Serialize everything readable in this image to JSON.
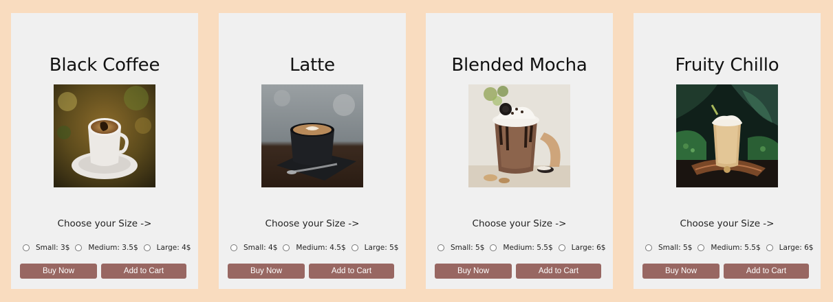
{
  "products": [
    {
      "name": "Black Coffee",
      "choose_label": "Choose your Size ->",
      "sizes": [
        "Small: 3$",
        "Medium: 3.5$",
        "Large: 4$"
      ],
      "buy_label": "Buy Now",
      "cart_label": "Add to Cart",
      "image_icon": "black-coffee-image"
    },
    {
      "name": "Latte",
      "choose_label": "Choose your Size ->",
      "sizes": [
        "Small: 4$",
        "Medium: 4.5$",
        "Large: 5$"
      ],
      "buy_label": "Buy Now",
      "cart_label": "Add to Cart",
      "image_icon": "latte-image"
    },
    {
      "name": "Blended Mocha",
      "choose_label": "Choose your Size ->",
      "sizes": [
        "Small: 5$",
        "Medium: 5.5$",
        "Large: 6$"
      ],
      "buy_label": "Buy Now",
      "cart_label": "Add to Cart",
      "image_icon": "blended-mocha-image"
    },
    {
      "name": "Fruity Chillo",
      "choose_label": "Choose your Size ->",
      "sizes": [
        "Small: 5$",
        "Medium: 5.5$",
        "Large: 6$"
      ],
      "buy_label": "Buy Now",
      "cart_label": "Add to Cart",
      "image_icon": "fruity-chillo-image"
    }
  ],
  "colors": {
    "page_background": "#f9dcbf",
    "card_background": "#f0f0f0",
    "button": "#986762",
    "button_text": "#ffffff"
  }
}
